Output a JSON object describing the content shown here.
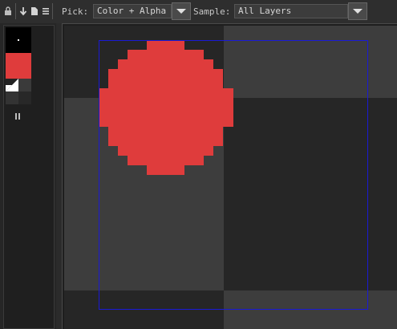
{
  "toolbar": {
    "pick_label": "Pick:",
    "pick_value": "Color + Alpha",
    "sample_label": "Sample:",
    "sample_value": "All Layers"
  },
  "colors": {
    "primary_red": "#df3c3c",
    "selection_blue": "#1a1ad6",
    "checker_dark": "#262626",
    "checker_light": "#3d3d3d"
  },
  "icons": [
    "lock-icon",
    "arrow-down-icon",
    "page-icon",
    "menu-icon",
    "pause-icon"
  ]
}
